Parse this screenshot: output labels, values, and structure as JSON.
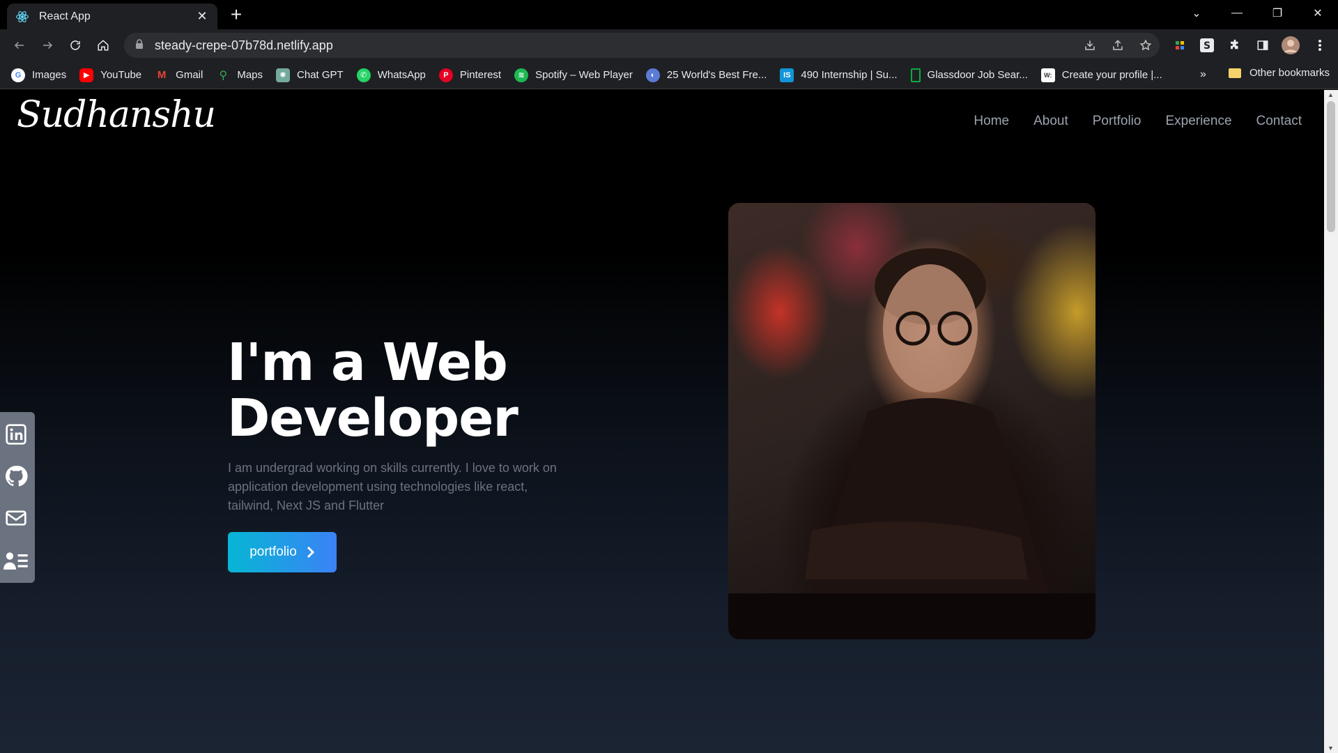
{
  "browser": {
    "tab_title": "React App",
    "url": "steady-crepe-07b78d.netlify.app",
    "bookmarks": [
      {
        "label": "Images",
        "icon": "google-icon",
        "color": "#4285f4"
      },
      {
        "label": "YouTube",
        "icon": "youtube-icon",
        "color": "#ff0000"
      },
      {
        "label": "Gmail",
        "icon": "gmail-icon",
        "color": "#ea4335"
      },
      {
        "label": "Maps",
        "icon": "maps-icon",
        "color": "#34a853"
      },
      {
        "label": "Chat GPT",
        "icon": "chatgpt-icon",
        "color": "#74aa9c"
      },
      {
        "label": "WhatsApp",
        "icon": "whatsapp-icon",
        "color": "#25d366"
      },
      {
        "label": "Pinterest",
        "icon": "pinterest-icon",
        "color": "#e60023"
      },
      {
        "label": "Spotify – Web Player",
        "icon": "spotify-icon",
        "color": "#1db954"
      },
      {
        "label": "25 World's Best Fre...",
        "icon": "globe-icon",
        "color": "#5b7bd5"
      },
      {
        "label": "490 Internship | Su...",
        "icon": "internshala-icon",
        "color": "#1295d8"
      },
      {
        "label": "Glassdoor Job Sear...",
        "icon": "glassdoor-icon",
        "color": "#0caa41"
      },
      {
        "label": "Create your profile |...",
        "icon": "profile-icon",
        "color": "#ffffff"
      }
    ],
    "bookmarks_more": "»",
    "other_bookmarks": "Other bookmarks"
  },
  "site": {
    "logo": "Sudhanshu",
    "nav": [
      "Home",
      "About",
      "Portfolio",
      "Experience",
      "Contact"
    ],
    "hero": {
      "title_line1": "I'm a Web",
      "title_line2": "Developer",
      "description": "I am undergrad working on skills currently. I love to work on application development using technologies like react, tailwind, Next JS and Flutter",
      "button_label": "portfolio"
    },
    "social": [
      "linkedin-icon",
      "github-icon",
      "mail-icon",
      "resume-icon"
    ]
  },
  "colors": {
    "accent_start": "#06b6d4",
    "accent_end": "#3b82f6",
    "nav_text": "#9ca3af"
  }
}
